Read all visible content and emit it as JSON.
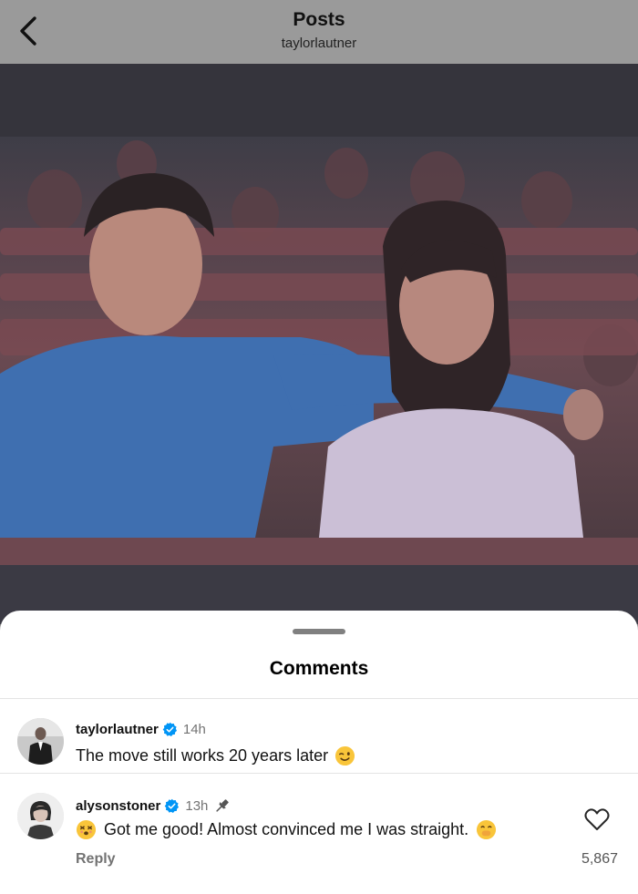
{
  "header": {
    "title": "Posts",
    "username": "taylorlautner"
  },
  "comments_sheet": {
    "title": "Comments",
    "comments": [
      {
        "username": "taylorlautner",
        "verified": true,
        "time": "14h",
        "text": "The move still works 20 years later",
        "emoji": "winking-face"
      },
      {
        "username": "alysonstoner",
        "verified": true,
        "time": "13h",
        "pinned": true,
        "text": "Got me good! Almost convinced me I was straight.",
        "leading_emoji": "dizzy-face",
        "trailing_emoji": "face-with-hand-over-mouth",
        "reply_label": "Reply",
        "like_count": "5,867"
      }
    ]
  },
  "colors": {
    "verified_blue": "#0095f6",
    "secondary_text": "#737373",
    "dim_overlay": "#9a9a9a"
  },
  "icons": [
    "chevron-left-icon",
    "verified-badge-icon",
    "pin-icon",
    "heart-icon"
  ]
}
